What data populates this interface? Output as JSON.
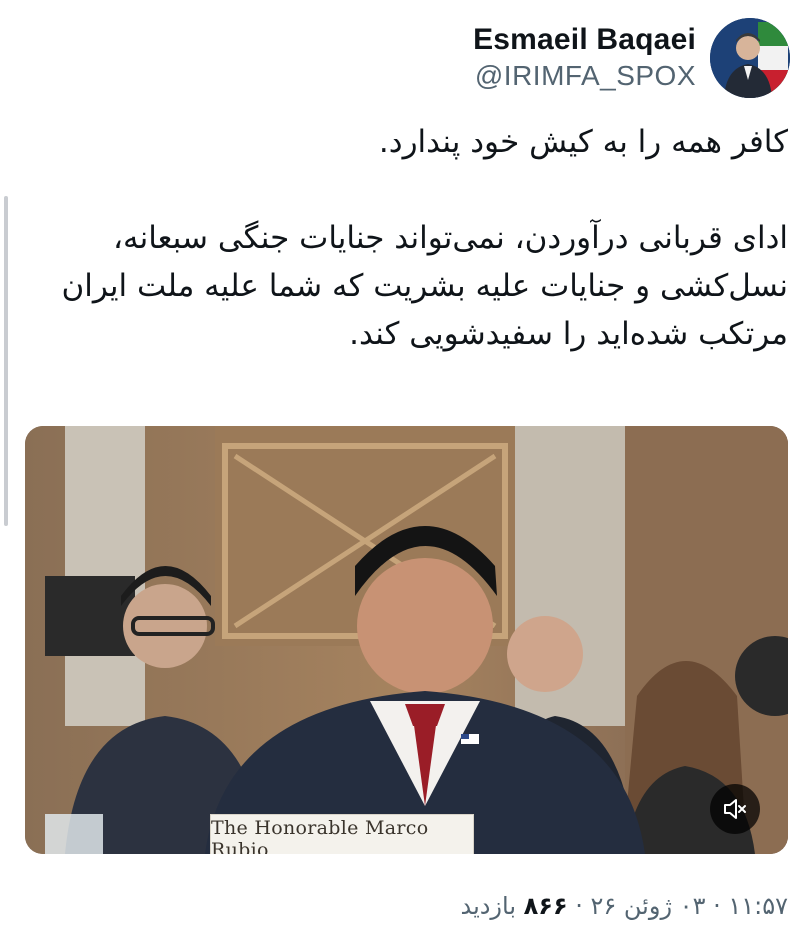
{
  "author": {
    "display_name": "Esmaeil Baqaei",
    "handle": "@IRIMFA_SPOX",
    "avatar_icon": "profile-photo-icon"
  },
  "tweet": {
    "line1": "کافر همه را به کیش خود پندارد.",
    "line2": "ادای قربانی درآوردن، نمی‌تواند جنایات جنگی سبعانه،",
    "line3": "نسل‌کشی و جنایات علیه بشریت که شما علیه ملت ایران",
    "line4": "مرتکب شده‌اید را سفیدشویی کند."
  },
  "media": {
    "nameplate_text": "The Honorable Marco Rubio",
    "mute_icon": "muted-speaker-icon"
  },
  "meta": {
    "time": "۱۱:۵۷",
    "sep1": " · ",
    "date": "۰۳ ژوئن ۲۶",
    "sep2": " · ",
    "views_count": "۸۶۶",
    "views_label": " بازدید"
  },
  "colors": {
    "text_primary": "#0f1419",
    "text_secondary": "#536471"
  }
}
